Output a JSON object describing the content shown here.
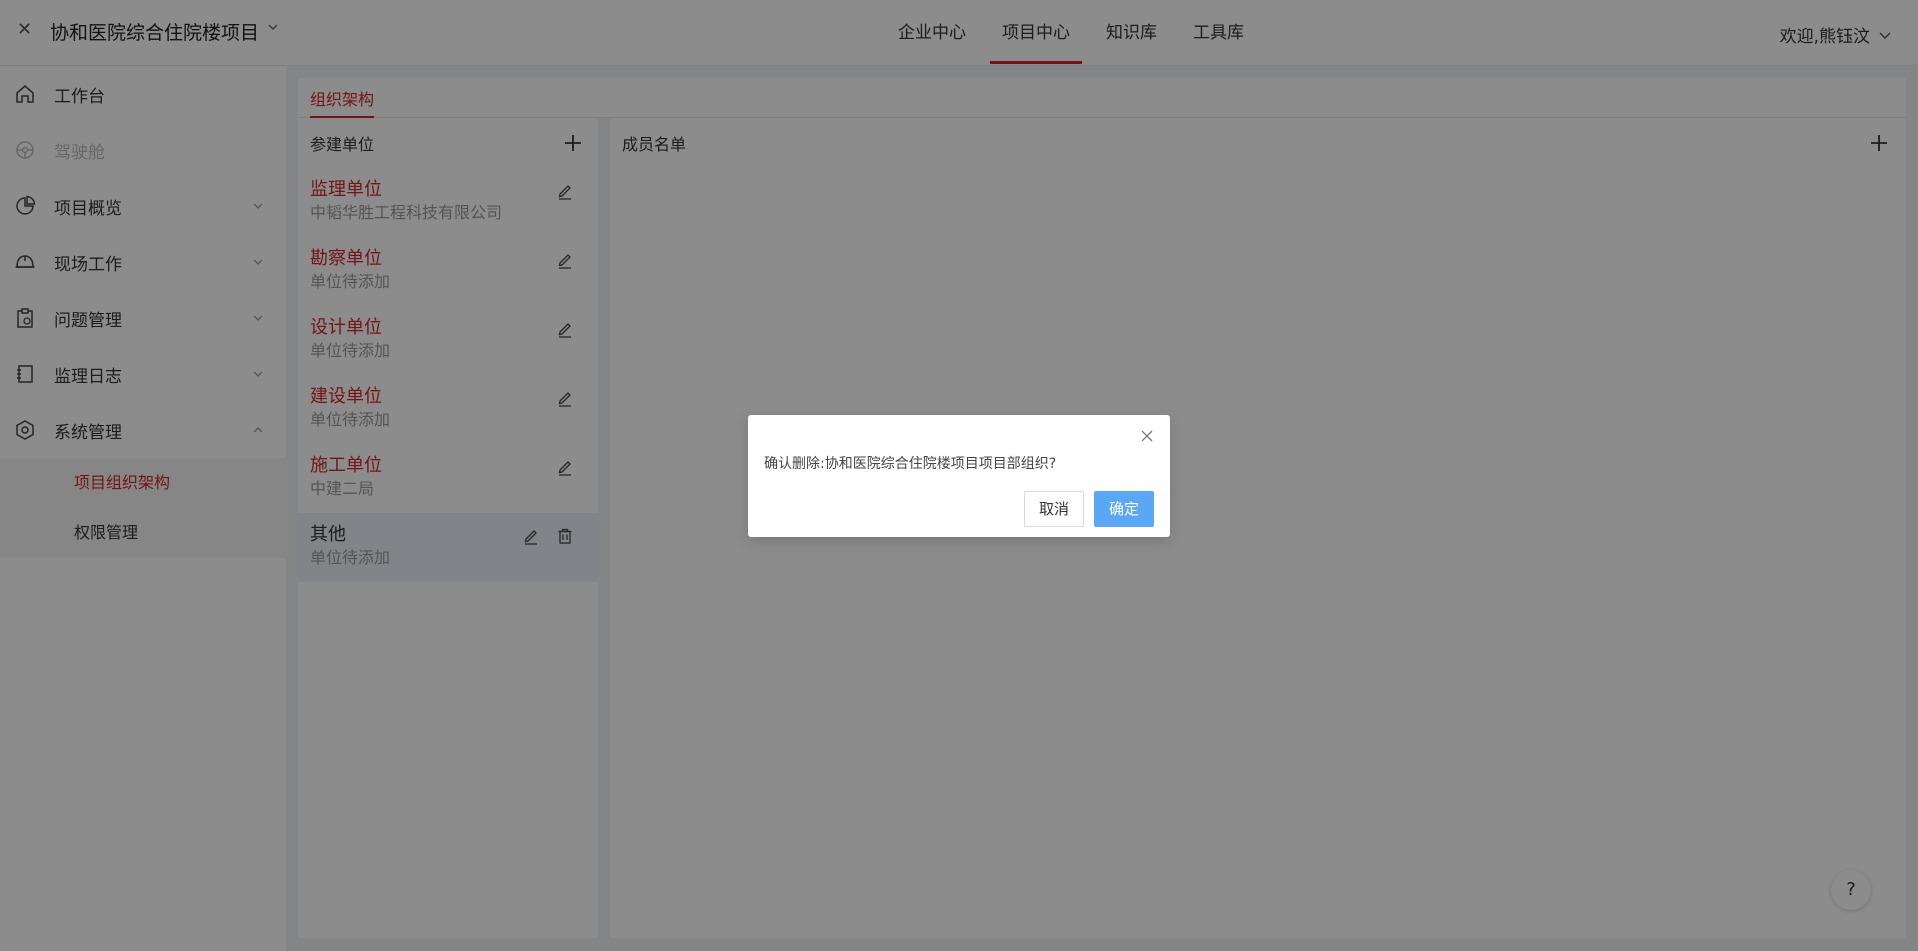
{
  "header": {
    "project_title": "协和医院综合住院楼项目",
    "nav": [
      {
        "label": "企业中心"
      },
      {
        "label": "项目中心"
      },
      {
        "label": "知识库"
      },
      {
        "label": "工具库"
      }
    ],
    "welcome": "欢迎,熊钰汶"
  },
  "sidebar": {
    "items": [
      {
        "label": "工作台"
      },
      {
        "label": "驾驶舱"
      },
      {
        "label": "项目概览"
      },
      {
        "label": "现场工作"
      },
      {
        "label": "问题管理"
      },
      {
        "label": "监理日志"
      },
      {
        "label": "系统管理"
      }
    ],
    "sub_items": [
      {
        "label": "项目组织架构"
      },
      {
        "label": "权限管理"
      }
    ]
  },
  "tabs": {
    "active": "组织架构"
  },
  "units_panel": {
    "title": "参建单位",
    "units": [
      {
        "name": "监理单位",
        "desc": "中韬华胜工程科技有限公司"
      },
      {
        "name": "勘察单位",
        "desc": "单位待添加"
      },
      {
        "name": "设计单位",
        "desc": "单位待添加"
      },
      {
        "name": "建设单位",
        "desc": "单位待添加"
      },
      {
        "name": "施工单位",
        "desc": "中建二局"
      },
      {
        "name": "其他",
        "desc": "单位待添加"
      }
    ]
  },
  "members_panel": {
    "title": "成员名单"
  },
  "help": {
    "label": "?"
  },
  "modal": {
    "message": "确认删除:协和医院综合住院楼项目项目部组织?",
    "cancel_label": "取消",
    "ok_label": "确定"
  },
  "colors": {
    "accent": "#d4262b",
    "primary_button": "#5aa8f5"
  }
}
